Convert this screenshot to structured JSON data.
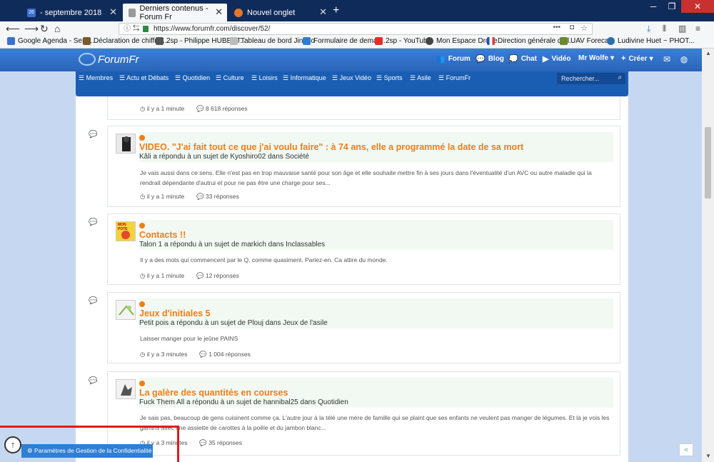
{
  "browser": {
    "tabs": [
      {
        "label": "- septembre 2018",
        "favicon_text": "26"
      },
      {
        "label": "Derniers contenus - Forum Fr"
      },
      {
        "label": "Nouvel onglet"
      }
    ],
    "url": "https://www.forumfr.com/discover/52/",
    "bookmarks": [
      "Google Agenda - Sem...",
      "Déclaration de chiffre ...",
      "2sp - Philippe HUBERT...",
      "Tableau de bord Jingoo",
      "Formulaire de deman...",
      "2sp - YouTube",
      "Mon Espace Drone",
      "Direction générale de l...",
      "UAV Forecast",
      "Ludivine Huet ~ PHOT..."
    ]
  },
  "site": {
    "logo": "ForumFr",
    "nav": {
      "forum": "Forum",
      "blog": "Blog",
      "chat": "Chat",
      "video": "Vidéo",
      "user": "Mr Wolfe",
      "create": "Créer"
    },
    "categories": [
      "Membres",
      "Actu et Débats",
      "Quotidien",
      "Culture",
      "Loisirs",
      "Informatique",
      "Jeux Vidéo",
      "Sports",
      "Asile",
      "ForumFr"
    ],
    "search_placeholder": "Rechercher..."
  },
  "feed": {
    "top_meta": {
      "time": "il y a 1 minute",
      "replies": "8 618 réponses"
    },
    "posts": [
      {
        "title": "VIDEO. \"J'ai fait tout ce que j'ai voulu faire\" : à 74 ans, elle a programmé la date de sa mort",
        "subtitle": "Kâli a répondu à un sujet de Kyoshiro02 dans Société",
        "excerpt": "Je vais aussi dans ce sens. Elle n'est pas en trop mauvaise santé pour son âge et elle souhaite mettre fin à ses jours dans l'éventualité d'un AVC ou autre maladie qui la rendrait dépendante d'autrui et pour ne pas être une charge pour ses...",
        "time": "il y a 1 minute",
        "replies": "33 réponses"
      },
      {
        "title": "Contacts !!",
        "subtitle": "Talon 1 a répondu à un sujet de markich dans Inclassables",
        "excerpt": "Il y a des mots qui commencent par le Q, comme quasiment. Parlez-en. Ca attire du monde.",
        "time": "il y a 1 minute",
        "replies": "12 réponses",
        "avatar_text": "MON POTE"
      },
      {
        "title": "Jeux d'initiales 5",
        "subtitle": "Petit pois a répondu à un sujet de Plouj dans Jeux de l'asile",
        "excerpt": "Laisser manger pour le jeûne PAINS",
        "time": "il y a 3 minutes",
        "replies": "1 004 réponses"
      },
      {
        "title": "La galère des quantités en courses",
        "subtitle": "Fuck Them All a répondu à un sujet de hannibal25 dans Quotidien",
        "excerpt": "Je sais pas, beaucoup de gens cuisinent comme ça. L'autre jour à la télé une mère de famille qui se plaint que ses enfants ne veulent pas manger de légumes. Et là je vois les gamins avec une assiette de carottes à la poêle et du jambon blanc...",
        "time": "il y a 3 minutes",
        "replies": "35 réponses"
      }
    ]
  },
  "privacy_label": "Paramètres de Gestion de la Confidentialité",
  "colors": {
    "accent": "#f07d19",
    "header": "#2a64b9",
    "category_bar": "#1a5eb3",
    "title_band": "#f1f9f2"
  }
}
